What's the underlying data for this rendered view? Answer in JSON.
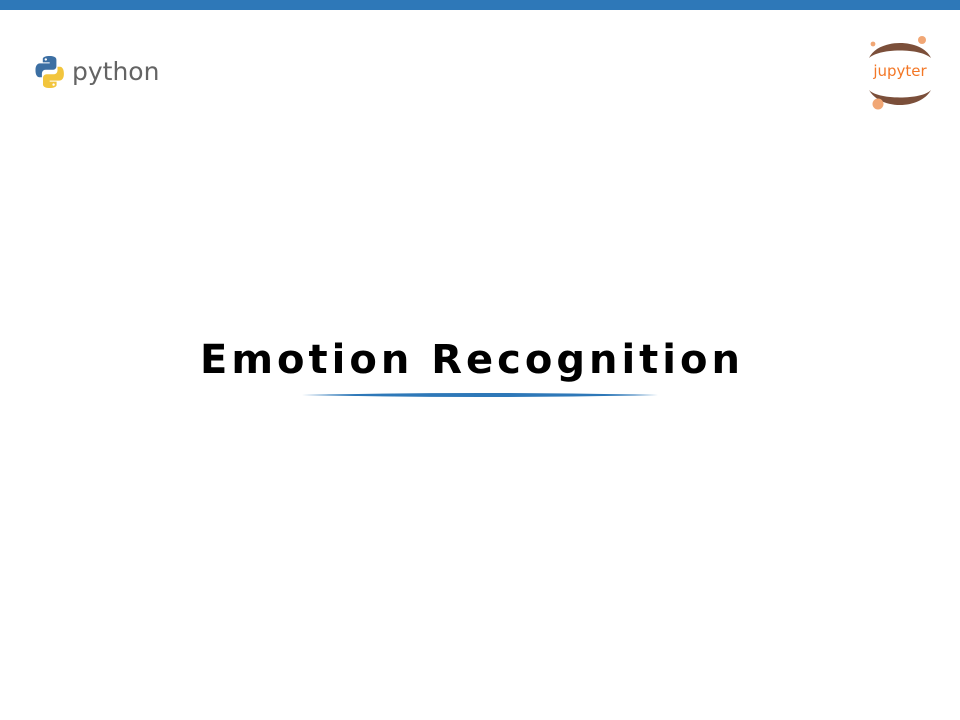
{
  "slide": {
    "title": "Emotion Recognition"
  },
  "logos": {
    "python": {
      "icon": "python-icon",
      "wordmark": "python"
    },
    "jupyter": {
      "icon": "jupyter-icon",
      "wordmark": "jupyter"
    }
  },
  "colors": {
    "accent_bar": "#2e78b8",
    "title_underline": "#2e78b8",
    "python_blue": "#3c6fa3",
    "python_yellow": "#f2c53d",
    "jupyter_orange": "#f37726",
    "jupyter_brown": "#7b4f3a",
    "jupyter_text": "#f1a775"
  }
}
